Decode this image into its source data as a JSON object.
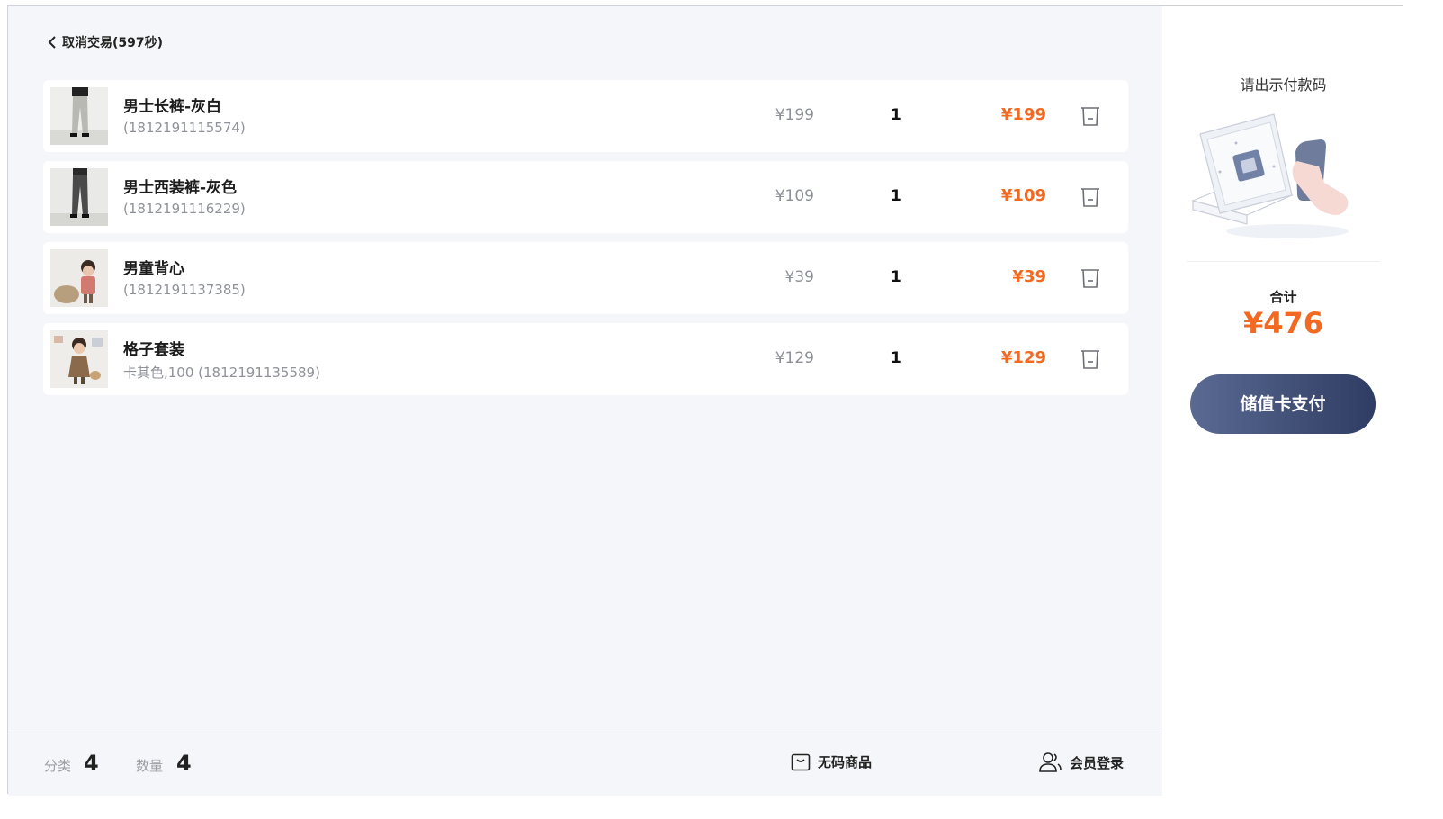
{
  "header": {
    "back_label": "取消交易(597秒)"
  },
  "items": [
    {
      "name": "男士长裤-灰白",
      "sub": "(1812191115574)",
      "price": "¥199",
      "qty": "1",
      "amount": "¥199"
    },
    {
      "name": "男士西装裤-灰色",
      "sub": "(1812191116229)",
      "price": "¥109",
      "qty": "1",
      "amount": "¥109"
    },
    {
      "name": "男童背心",
      "sub": "(1812191137385)",
      "price": "¥39",
      "qty": "1",
      "amount": "¥39"
    },
    {
      "name": "格子套装",
      "sub": "卡其色,100 (1812191135589)",
      "price": "¥129",
      "qty": "1",
      "amount": "¥129"
    }
  ],
  "footer": {
    "category_label": "分类",
    "category_count": "4",
    "quantity_label": "数量",
    "quantity_count": "4",
    "no_barcode_label": "无码商品",
    "member_login_label": "会员登录"
  },
  "payment": {
    "prompt": "请出示付款码",
    "total_label": "合计",
    "total_value": "¥476",
    "pay_button_label": "储值卡支付"
  },
  "colors": {
    "accent": "#f26922",
    "button_dark": "#2f3c63",
    "button_light": "#5a6a92"
  }
}
